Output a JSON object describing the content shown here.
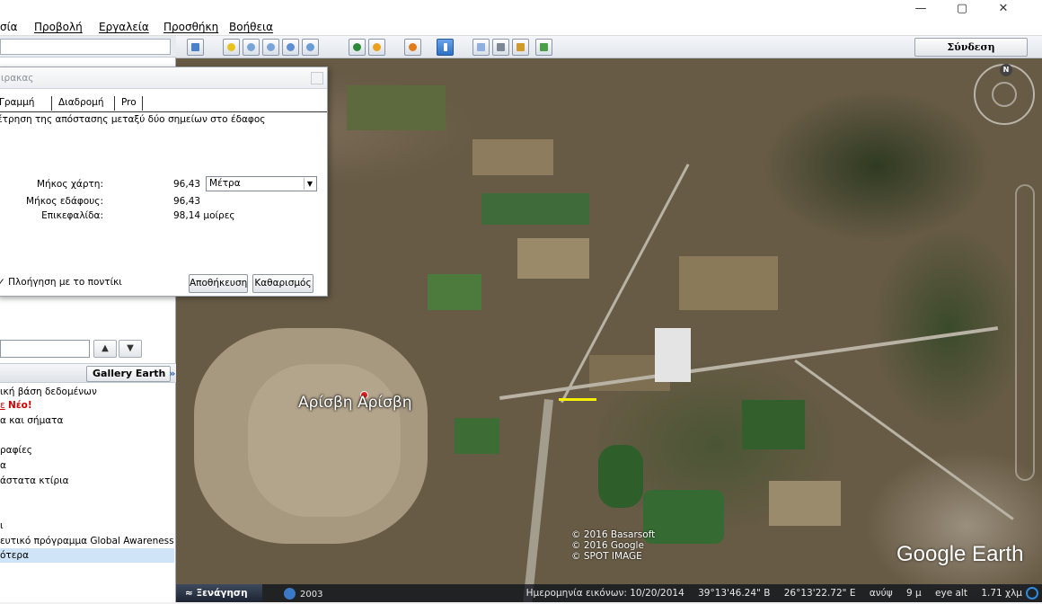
{
  "window": {
    "min_glyph": "—",
    "max_glyph": "▢",
    "close_glyph": "✕"
  },
  "menu": [
    {
      "label": "σία"
    },
    {
      "label": "Προβολή"
    },
    {
      "label": "Εργαλεία"
    },
    {
      "label": "Προσθήκη"
    },
    {
      "label": "Βοήθεια"
    }
  ],
  "toolbar": {
    "buttons": [
      "sidebar-icon",
      "placemark-icon",
      "polygon-icon",
      "path-icon",
      "image-overlay-icon",
      "record-tour-icon",
      "historical-imagery-icon",
      "sunlight-icon",
      "planets-icon",
      "ruler-icon",
      "email-icon",
      "print-icon",
      "save-image-icon",
      "maps-icon"
    ],
    "signin_label": "Σύνδεση"
  },
  "ruler": {
    "title": "ιρακας",
    "tabs": [
      "Γραμμή",
      "Διαδρομή",
      "Pro"
    ],
    "description": "έτρηση της απόστασης μεταξύ δύο σημείων στο έδαφος",
    "map_length_label": "Μήκος χάρτη:",
    "map_length_value": "96,43",
    "unit": "Μέτρα",
    "ground_length_label": "Μήκος εδάφους:",
    "ground_length_value": "96,43",
    "heading_label": "Επικεφαλίδα:",
    "heading_value": "98,14 μοίρες",
    "mouse_nav_label": "Πλοήγηση με το ποντίκι",
    "check_glyph": "✓",
    "save_label": "Αποθήκευση",
    "clear_label": "Καθαρισμός"
  },
  "layers": {
    "up_glyph": "▲",
    "down_glyph": "▼",
    "gallery_label": "Gallery Earth",
    "gallery_chevron": "»",
    "items": [
      {
        "text": "ική βάση δεδομένων"
      },
      {
        "prefix": "ε",
        "new_label": "Νέο!"
      },
      {
        "text": "α και σήματα"
      },
      {
        "text": ""
      },
      {
        "text": "ραφίες"
      },
      {
        "text": "α"
      },
      {
        "text": "άστατα κτίρια"
      },
      {
        "text": ""
      },
      {
        "text": ""
      },
      {
        "text": "ι"
      },
      {
        "text": "ευτικό πρόγραμμα Global Awareness"
      },
      {
        "text": "ότερα"
      }
    ]
  },
  "map": {
    "place_name": "Αρίσβη Αρίσβη",
    "copyright": "© 2016 Basarsoft\n© 2016 Google\n© SPOT IMAGE",
    "logo": "Google Earth",
    "compass_n": "N"
  },
  "status": {
    "tour_label": "≈ Ξενάγηση",
    "history_year": "2003",
    "imagery_date": "Ημερομηνία εικόνων: 10/20/2014",
    "lat": "39°13'46.24\" B",
    "lon": "26°13'22.72\" E",
    "elev": "ανύψ",
    "elev_val": "9 μ",
    "eye_alt": "eye alt",
    "eye_alt_val": "1.71 χλμ"
  },
  "colors": {
    "accent": "#2a62b8",
    "new_badge": "#d00000",
    "measure_line": "#f6f000"
  }
}
